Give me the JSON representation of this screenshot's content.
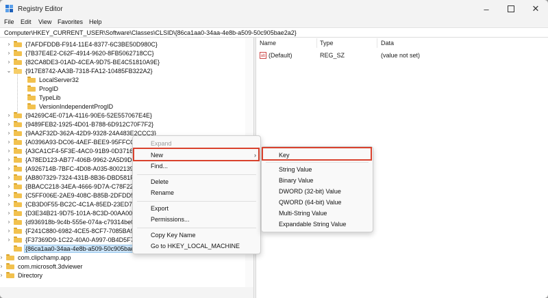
{
  "window": {
    "title": "Registry Editor"
  },
  "menubar": [
    "File",
    "Edit",
    "View",
    "Favorites",
    "Help"
  ],
  "address": "Computer\\HKEY_CURRENT_USER\\Software\\Classes\\CLSID\\{86ca1aa0-34aa-4e8b-a509-50c905bae2a2}",
  "tree": [
    {
      "label": "{7AFDFDDB-F914-11E4-8377-6C3BE50D980C}"
    },
    {
      "label": "{7B37E4E2-C62F-4914-9620-8FB5062718CC}"
    },
    {
      "label": "{82CA8DE3-01AD-4CEA-9D75-BE4C51810A9E}"
    },
    {
      "label": "{917E8742-AA3B-7318-FA12-10485FB322A2}"
    },
    {
      "label": "LocalServer32"
    },
    {
      "label": "ProgID"
    },
    {
      "label": "TypeLib"
    },
    {
      "label": "VersionIndependentProgID"
    },
    {
      "label": "{94269C4E-071A-4116-90E6-52E557067E4E}"
    },
    {
      "label": "{9489FEB2-1925-4D01-B788-6D912C70F7F2}"
    },
    {
      "label": "{9AA2F32D-362A-42D9-9328-24A483E2CCC3}"
    },
    {
      "label": "{A0396A93-DC06-4AEF-BEE9-95FFCCAE"
    },
    {
      "label": "{A3CA1CF4-5F3E-4AC0-91B9-0D3716E1"
    },
    {
      "label": "{A78ED123-AB77-406B-9962-2A5D9D2F7"
    },
    {
      "label": "{A926714B-7BFC-4D08-A035-80021395F"
    },
    {
      "label": "{AB807329-7324-431B-8B36-DBD581F56"
    },
    {
      "label": "{BBACC218-34EA-4666-9D7A-C78F2274"
    },
    {
      "label": "{C5FF006E-2AE9-408C-B85B-2DFDD5449"
    },
    {
      "label": "{CB3D0F55-BC2C-4C1A-85ED-23ED75B5"
    },
    {
      "label": "{D3E34B21-9D75-101A-8C3D-00AA001A"
    },
    {
      "label": "{d936918b-9c4b-555e-074a-c79314be04"
    },
    {
      "label": "{F241C880-6982-4CE5-8CF7-7085BA96D"
    },
    {
      "label": "{F37369D9-1C22-40A0-A997-0B4D5F7B6"
    },
    {
      "label": "{86ca1aa0-34aa-4e8b-a509-50c905bae2a2}"
    },
    {
      "label": "com.clipchamp.app"
    },
    {
      "label": "com.microsoft.3dviewer"
    },
    {
      "label": "Directory"
    }
  ],
  "columns": {
    "name": "Name",
    "type": "Type",
    "data": "Data"
  },
  "values": [
    {
      "name": "(Default)",
      "type": "REG_SZ",
      "data": "(value not set)",
      "icon": "ab-icon"
    }
  ],
  "context_menu": {
    "expand": "Expand",
    "new": "New",
    "find": "Find...",
    "delete": "Delete",
    "rename": "Rename",
    "export": "Export",
    "permissions": "Permissions...",
    "copy_key_name": "Copy Key Name",
    "goto": "Go to HKEY_LOCAL_MACHINE"
  },
  "submenu": {
    "key": "Key",
    "string": "String Value",
    "binary": "Binary Value",
    "dword": "DWORD (32-bit) Value",
    "qword": "QWORD (64-bit) Value",
    "multi": "Multi-String Value",
    "expandable": "Expandable String Value"
  },
  "colors": {
    "highlight": "#d9412c",
    "selection": "#cce4f7"
  }
}
